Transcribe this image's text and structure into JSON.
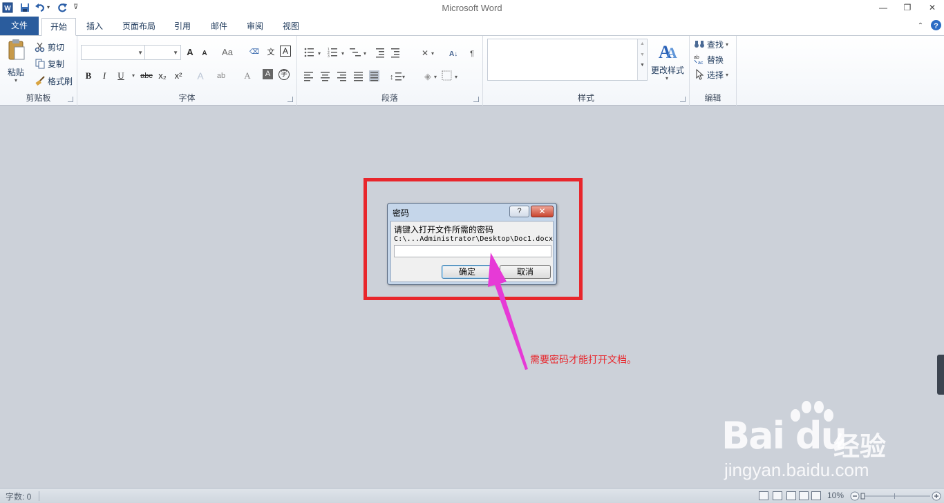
{
  "window": {
    "title": "Microsoft Word",
    "controls": {
      "minimize": "—",
      "restore": "❐",
      "close": "✕"
    }
  },
  "tabs": {
    "file": "文件",
    "home": "开始",
    "insert": "插入",
    "page_layout": "页面布局",
    "references": "引用",
    "mailings": "邮件",
    "review": "审阅",
    "view": "视图"
  },
  "ribbon": {
    "clipboard": {
      "label": "剪贴板",
      "paste": "粘贴",
      "cut": "剪切",
      "copy": "复制",
      "format_painter": "格式刷"
    },
    "font": {
      "label": "字体",
      "font_name": "",
      "font_size": "",
      "bold": "B",
      "italic": "I",
      "underline": "U",
      "strike": "abc",
      "subscript": "x₂",
      "superscript": "x²",
      "grow": "A",
      "shrink": "A",
      "case": "Aa",
      "font_color": "A"
    },
    "paragraph": {
      "label": "段落"
    },
    "styles": {
      "label": "样式",
      "change_styles": "更改样式"
    },
    "editing": {
      "label": "编辑",
      "find": "查找",
      "replace": "替换",
      "select": "选择"
    }
  },
  "dialog": {
    "title": "密码",
    "help": "?",
    "close": "✕",
    "prompt": "请键入打开文件所需的密码",
    "path": "C:\\...Administrator\\Desktop\\Doc1.docx",
    "password_value": "",
    "ok": "确定",
    "cancel": "取消"
  },
  "annotation": {
    "text": "需要密码才能打开文档。",
    "color": "#e8262c"
  },
  "watermark": {
    "logo": "Bai du",
    "jingyan": "经验",
    "url": "jingyan.baidu.com"
  },
  "statusbar": {
    "word_count": "字数: 0",
    "zoom": "10%"
  },
  "colors": {
    "file_tab": "#2a5c9d",
    "highlight": "#e8262c",
    "arrow": "#e63ad6",
    "doc_bg": "#ccd1d9"
  }
}
